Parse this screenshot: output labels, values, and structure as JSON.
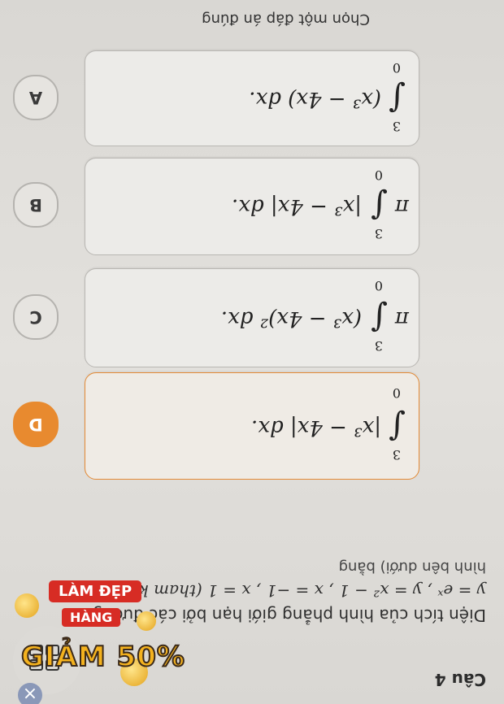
{
  "question": {
    "header": "Câu 4",
    "text_line1": "Diện tích của hình phẳng giới hạn bởi các đường",
    "text_line2": "y = eˣ , y = x² − 1 , x = −1 ,   x = 1 (tham khảo",
    "text_line3": "hình bên dưới) bằng"
  },
  "options": [
    {
      "letter": "A",
      "prefix": "",
      "integrand": "(x³ − 4x) dx.",
      "upper": "3",
      "lower": "0",
      "selected": false
    },
    {
      "letter": "B",
      "prefix": "π",
      "integrand": "|x³ − 4x| dx.",
      "upper": "3",
      "lower": "0",
      "selected": false
    },
    {
      "letter": "C",
      "prefix": "π",
      "integrand": "(x³ − 4x)² dx.",
      "upper": "3",
      "lower": "0",
      "selected": false
    },
    {
      "letter": "D",
      "prefix": "",
      "integrand": "|x³ − 4x| dx.",
      "upper": "3",
      "lower": "0",
      "selected": true
    }
  ],
  "instruction": "Chọn một đáp án đúng",
  "ad": {
    "label_top": "HÀNG",
    "label_bottom": "LÀM ĐẸP",
    "promo": "GIẢM 50%",
    "close_icon": "×"
  },
  "colors": {
    "accent": "#e88a2f",
    "ad_red": "#d72c24",
    "ad_gold": "#f4b21e"
  }
}
